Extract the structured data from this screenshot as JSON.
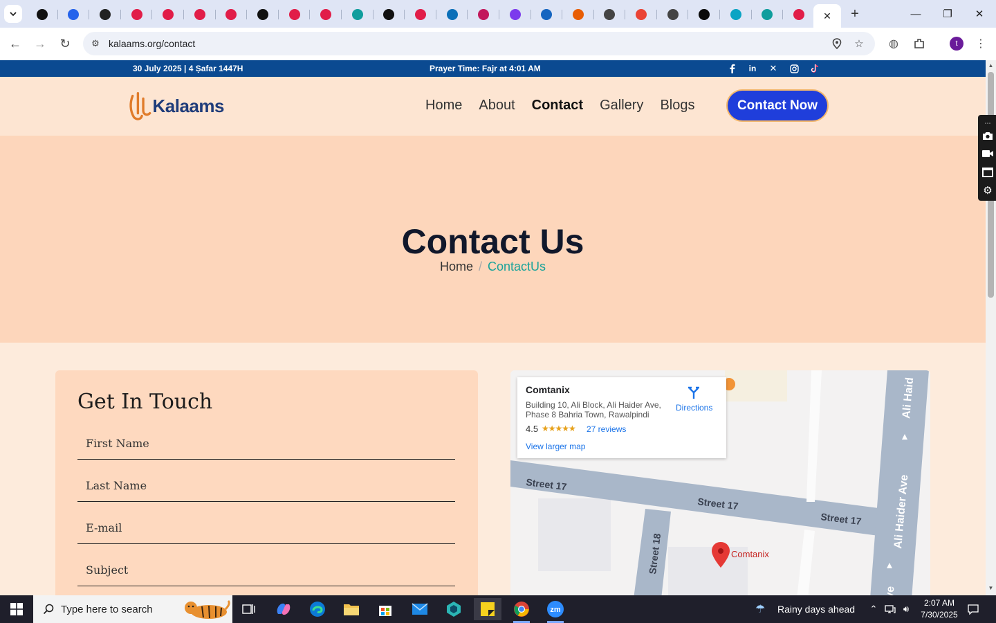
{
  "browser": {
    "tab_count": 25,
    "tab_favicon_colors": [
      "#111111",
      "#2563eb",
      "#222222",
      "#e11d48",
      "#e11d48",
      "#e11d48",
      "#e11d48",
      "#111111",
      "#e11d48",
      "#e11d48",
      "#0f9d9d",
      "#111111",
      "#e11d48",
      "#0b6fb8",
      "#c2185b",
      "#7c3aed",
      "#1565c0",
      "#e85d04",
      "#444444",
      "#ea4335",
      "#444444",
      "#0a0a0a",
      "#0aa4c4",
      "#0f9d9d",
      "#e11d48"
    ],
    "active_tab_close": "✕",
    "new_tab": "+",
    "url": "kalaams.org/contact",
    "profile_initial": "t"
  },
  "site": {
    "topbar": {
      "date": "30 July 2025 | 4 Ṣafar 1447H",
      "prayer": "Prayer Time: Fajr at 4:01 AM",
      "socials": [
        "facebook-icon",
        "linkedin-icon",
        "x-icon",
        "instagram-icon",
        "tiktok-icon"
      ]
    },
    "header": {
      "logo_text": "Kalaams",
      "nav": [
        {
          "label": "Home",
          "active": false
        },
        {
          "label": "About",
          "active": false
        },
        {
          "label": "Contact",
          "active": true
        },
        {
          "label": "Gallery",
          "active": false
        },
        {
          "label": "Blogs",
          "active": false
        }
      ],
      "cta": "Contact Now"
    },
    "hero": {
      "title": "Contact Us",
      "breadcrumb_home": "Home",
      "breadcrumb_sep": "/",
      "breadcrumb_current": "ContactUs"
    },
    "form": {
      "title": "Get In Touch",
      "fields": [
        "First Name",
        "Last Name",
        "E-mail",
        "Subject"
      ]
    },
    "map": {
      "place_name": "Comtanix",
      "address_line1": "Building 10, Ali Block, Ali Haider Ave,",
      "address_line2": "Phase 8 Bahria Town, Rawalpindi",
      "rating": "4.5",
      "stars": "★★★★★",
      "reviews": "27 reviews",
      "larger_map": "View larger map",
      "directions": "Directions",
      "streets": [
        "Street 17",
        "Street 17",
        "Street 17",
        "Street 18",
        "Ali Haider Ave",
        "Ali Haider Ave",
        "Ali Haid",
        "ve"
      ],
      "marker_label": "Comtanix"
    }
  },
  "taskbar": {
    "search_placeholder": "Type here to search",
    "weather": "Rainy days ahead",
    "time": "2:07 AM",
    "date": "7/30/2025"
  },
  "colors": {
    "topbar_bg": "#0b4a91",
    "header_bg": "#fde5d2",
    "hero_bg": "#fdd6bb",
    "cta_bg": "#1f3edb",
    "breadcrumb_current": "#1aa39a"
  }
}
